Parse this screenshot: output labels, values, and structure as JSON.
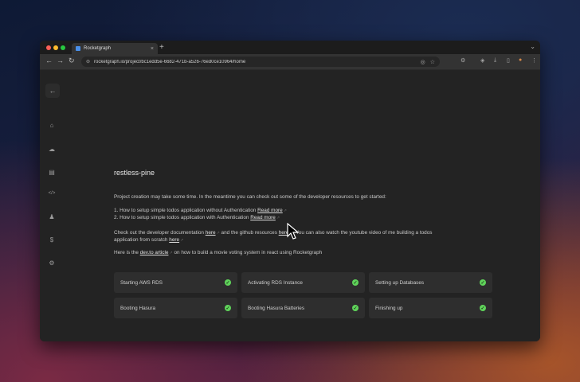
{
  "browser": {
    "tab_title": "Rocketgraph",
    "tab_close": "×",
    "new_tab": "+",
    "tab_menu": "⌄",
    "url": "rocketgraph.io/project/bc1edd5e-6682-471b-a526-76ed0ce10964/home",
    "nav": {
      "back": "←",
      "forward": "→",
      "reload": "↻"
    }
  },
  "sidebar": {
    "back": "←",
    "items": [
      {
        "icon": "home-icon",
        "glyph": "⌂"
      },
      {
        "icon": "cloud-icon",
        "glyph": "☁"
      },
      {
        "icon": "database-icon",
        "glyph": "▤"
      },
      {
        "icon": "code-icon",
        "glyph": "</>"
      },
      {
        "icon": "user-icon",
        "glyph": "♟"
      },
      {
        "icon": "billing-icon",
        "glyph": "$"
      },
      {
        "icon": "settings-icon",
        "glyph": "⚙"
      }
    ]
  },
  "main": {
    "project_name": "restless-pine",
    "intro": "Project creation may take some time. In the meantime you can check out some of the developer resources to get started:",
    "resources": [
      {
        "text": "1. How to setup simple todos application without Authentication",
        "link": "Read more"
      },
      {
        "text": "2. How to setup simple todos application with Authentication",
        "link": "Read more"
      }
    ],
    "docs": {
      "part1": "Check out the developer documentation",
      "link1": "here",
      "part2": "and the github resources",
      "link2": "here",
      "part3": ". You can also watch the youtube video of me building a todos",
      "line2_prefix": "application from scratch",
      "link3": "here"
    },
    "devto": {
      "prefix": "Here is the",
      "link": "dev.to article",
      "suffix": "on how to build a movie voting system in react using Rocketgraph"
    },
    "steps": [
      "Starting AWS RDS",
      "Activating RDS Instance",
      "Setting up Databases",
      "Booting Hasura",
      "Booting Hasura Batteries",
      "Finishing up"
    ],
    "check_glyph": "✓"
  }
}
